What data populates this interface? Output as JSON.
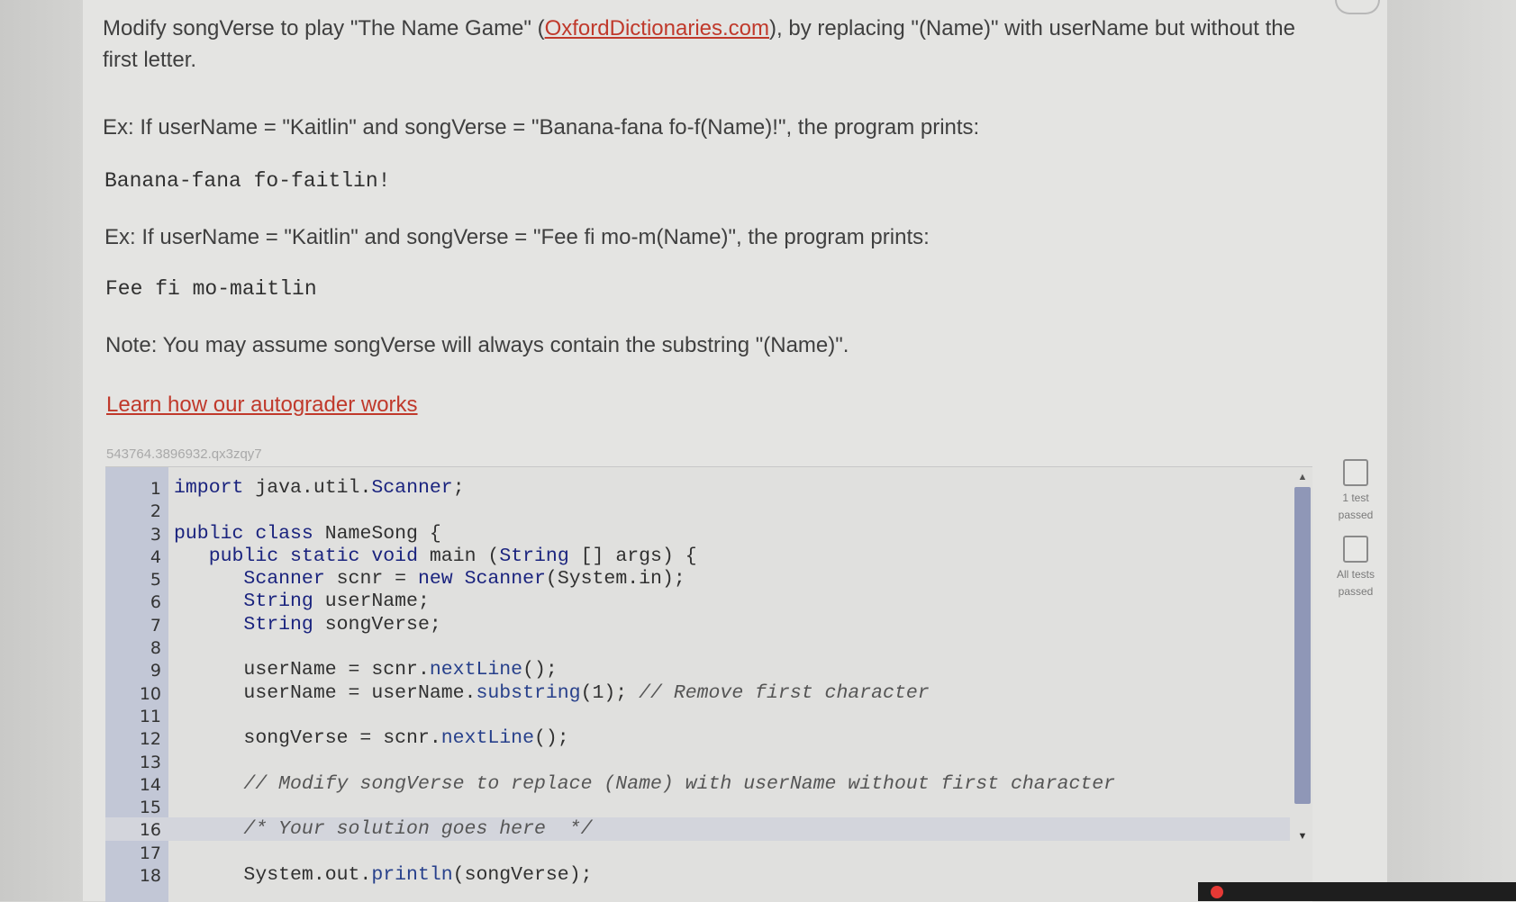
{
  "instructions": {
    "intro_before": "Modify songVerse to play \"The Name Game\" (",
    "intro_link": "OxfordDictionaries.com",
    "intro_after": "), by replacing \"(Name)\" with userName but without the first letter.",
    "example1": "Ex: If userName = \"Kaitlin\" and songVerse = \"Banana-fana fo-f(Name)!\", the program prints:",
    "output1": "Banana-fana fo-faitlin!",
    "example2": "Ex: If userName = \"Kaitlin\" and songVerse = \"Fee fi mo-m(Name)\", the program prints:",
    "output2": "Fee fi mo-maitlin",
    "note": "Note: You may assume songVerse will always contain the substring \"(Name)\".",
    "learn_link": "Learn how our autograder works"
  },
  "editor": {
    "code_id": "543764.3896932.qx3zqy7",
    "lines": [
      {
        "n": "1",
        "code": "import java.util.Scanner;"
      },
      {
        "n": "2",
        "code": ""
      },
      {
        "n": "3",
        "code": "public class NameSong {"
      },
      {
        "n": "4",
        "code": "   public static void main (String [] args) {"
      },
      {
        "n": "5",
        "code": "      Scanner scnr = new Scanner(System.in);"
      },
      {
        "n": "6",
        "code": "      String userName;"
      },
      {
        "n": "7",
        "code": "      String songVerse;"
      },
      {
        "n": "8",
        "code": ""
      },
      {
        "n": "9",
        "code": "      userName = scnr.nextLine();"
      },
      {
        "n": "10",
        "code": "      userName = userName.substring(1); // Remove first character"
      },
      {
        "n": "11",
        "code": ""
      },
      {
        "n": "12",
        "code": "      songVerse = scnr.nextLine();"
      },
      {
        "n": "13",
        "code": ""
      },
      {
        "n": "14",
        "code": "      // Modify songVerse to replace (Name) with userName without first character"
      },
      {
        "n": "15",
        "code": ""
      },
      {
        "n": "16",
        "code": "      /* Your solution goes here  */"
      },
      {
        "n": "17",
        "code": ""
      },
      {
        "n": "18",
        "code": "      System.out.println(songVerse);"
      }
    ],
    "active_line": "16"
  },
  "tests": {
    "one_line1": "1 test",
    "one_line2": "passed",
    "all_line1": "All tests",
    "all_line2": "passed"
  },
  "colors": {
    "link": "#c0392b",
    "gutter": "#c2c7d6",
    "scroll_thumb": "#8f97b7"
  }
}
